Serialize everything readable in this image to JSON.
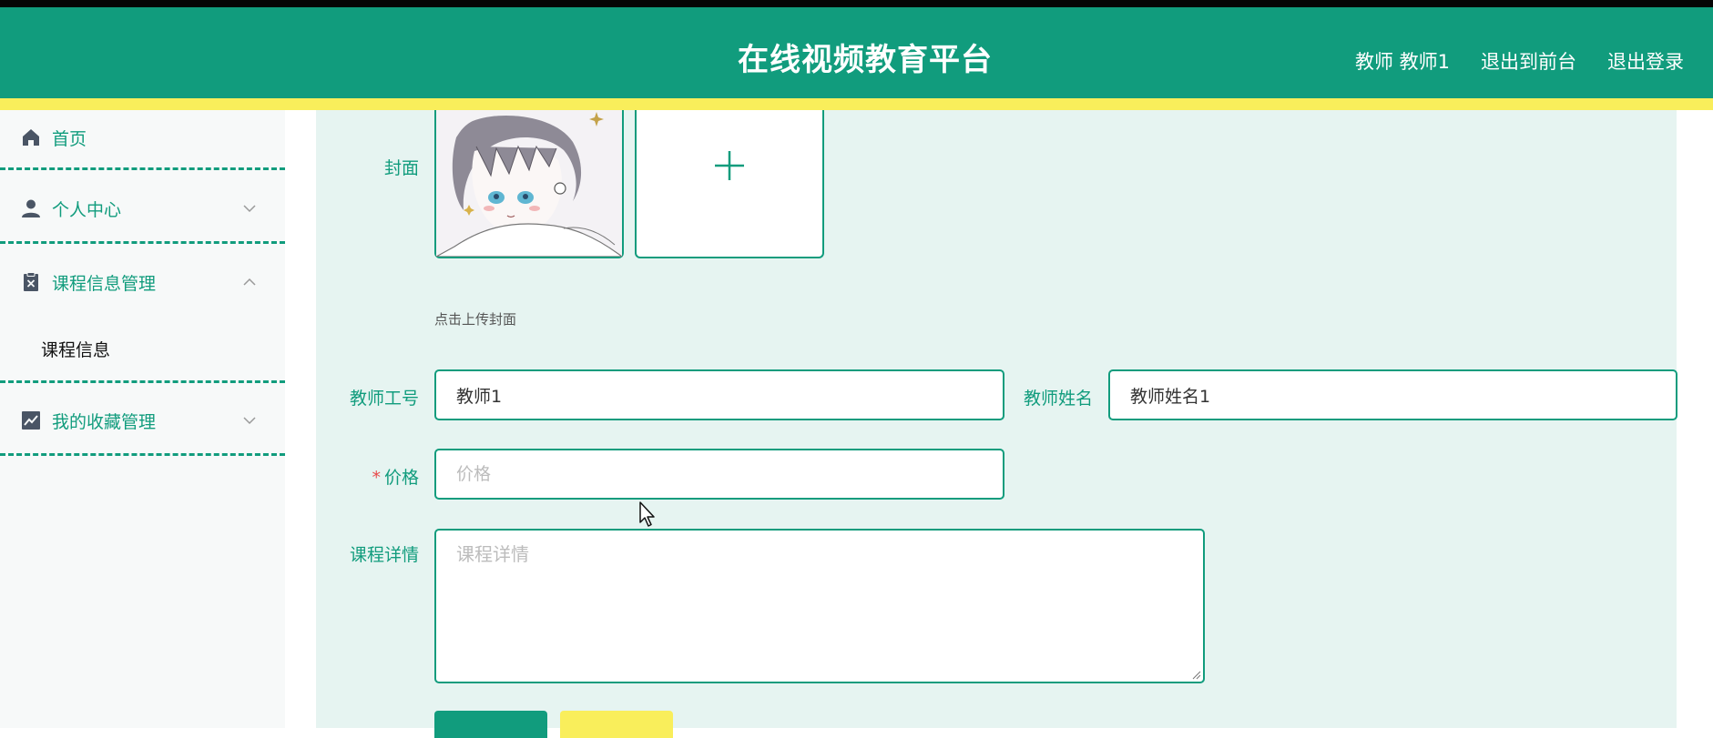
{
  "header": {
    "title": "在线视频教育平台",
    "nav": [
      {
        "label": "教师 教师1"
      },
      {
        "label": "退出到前台"
      },
      {
        "label": "退出登录"
      }
    ]
  },
  "sidebar": {
    "items": [
      {
        "label": "首页",
        "icon": "home-icon"
      },
      {
        "label": "个人中心",
        "icon": "user-icon"
      },
      {
        "label": "课程信息管理",
        "icon": "clipboard-icon"
      },
      {
        "label": "我的收藏管理",
        "icon": "chart-icon"
      }
    ],
    "sub_items": [
      {
        "label": "课程信息"
      }
    ]
  },
  "form": {
    "cover": {
      "label": "封面",
      "hint": "点击上传封面"
    },
    "teacher_id": {
      "label": "教师工号",
      "value": "教师1"
    },
    "teacher_name": {
      "label": "教师姓名",
      "value": "教师姓名1"
    },
    "price": {
      "label": "价格",
      "placeholder": "价格",
      "required_mark": "*"
    },
    "detail": {
      "label": "课程详情",
      "placeholder": "课程详情"
    }
  },
  "colors": {
    "primary": "#119c7d",
    "accent_yellow": "#f9ee5b",
    "main_bg": "#e6f4f1"
  }
}
